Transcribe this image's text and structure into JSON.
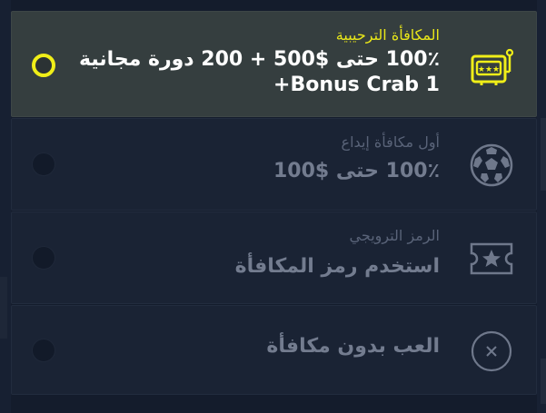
{
  "bonus_options": [
    {
      "subtitle": "المكافأة الترحيبية",
      "title_line1": "100٪ حتى $500 + 200 دورة مجانية",
      "title_line2": "Bonus Crab 1+",
      "icon": "slot-machine-icon",
      "selected": true
    },
    {
      "subtitle": "أول مكافأة إيداع",
      "title_line1": "100٪ حتى $100",
      "icon": "soccer-ball-icon",
      "selected": false
    },
    {
      "subtitle": "الرمز الترويجي",
      "title_line1": "استخدم رمز المكافأة",
      "icon": "star-ticket-icon",
      "selected": false
    },
    {
      "title_line1": "العب بدون مكافأة",
      "icon": "close-circle-icon",
      "selected": false
    }
  ],
  "colors": {
    "accent": "#f0ee18",
    "background": "#141c2c",
    "active_card": "#353e3f",
    "inactive_text": "#737c8f"
  }
}
